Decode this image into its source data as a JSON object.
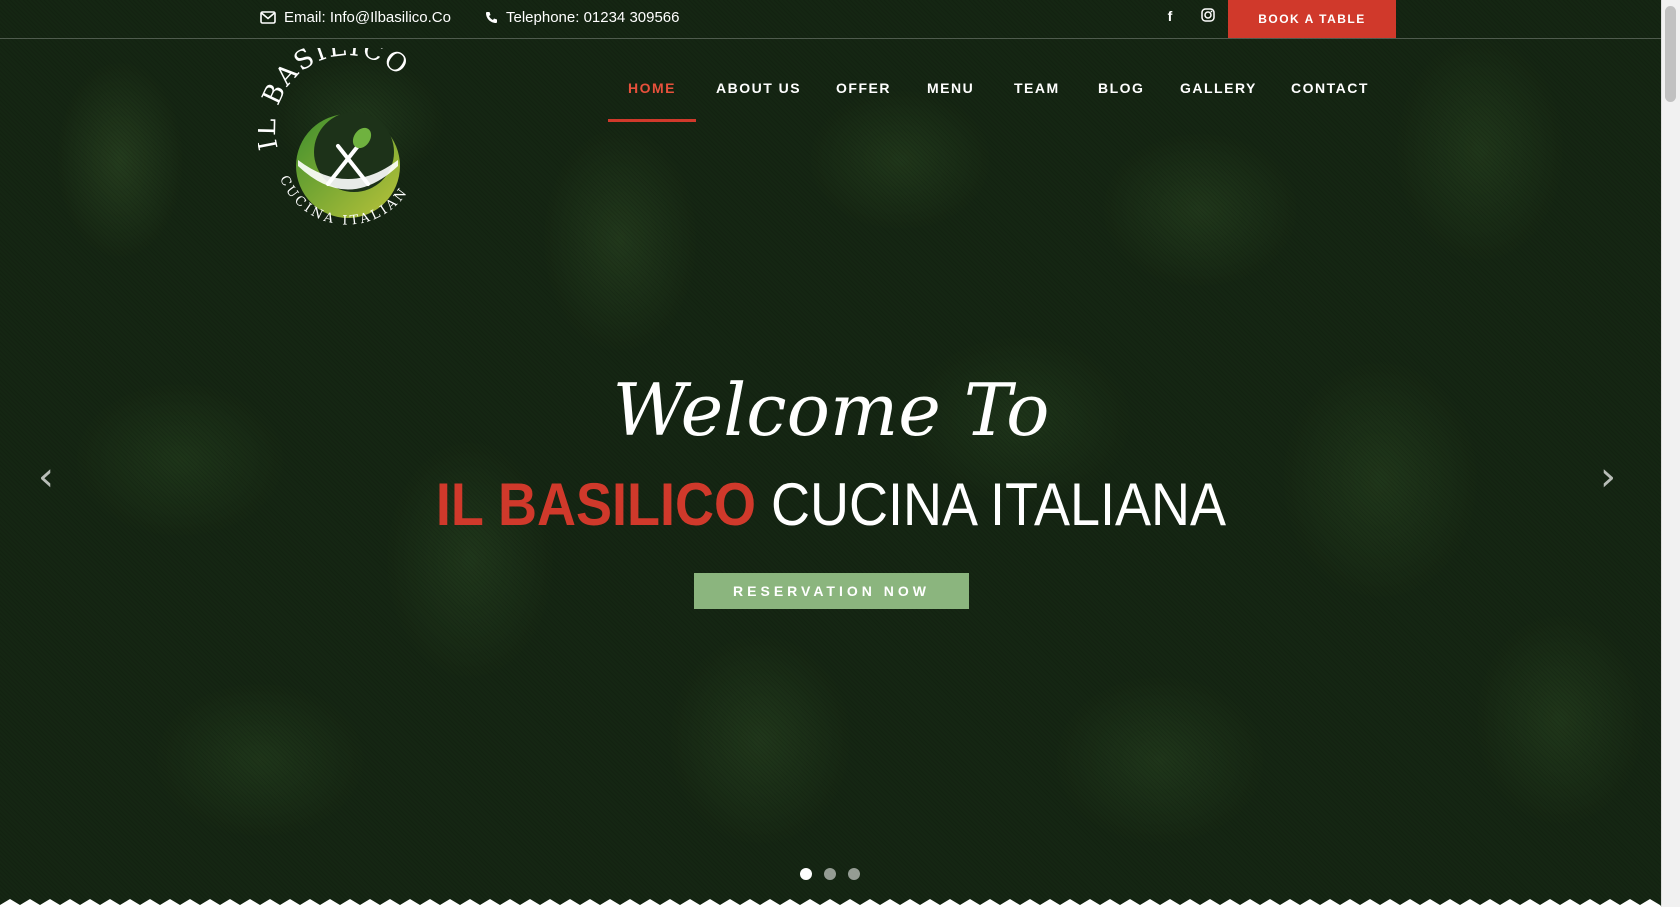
{
  "topbar": {
    "email_label": "Email: Info@Ilbasilico.Co",
    "phone_label": "Telephone: 01234 309566",
    "social": [
      {
        "icon": "facebook-icon",
        "glyph": "f"
      },
      {
        "icon": "instagram-icon",
        "glyph": "◎"
      }
    ],
    "book_label": "BOOK A TABLE"
  },
  "logo": {
    "top_text": "IL BASILICO",
    "bottom_text": "CUCINA ITALIANA"
  },
  "nav": {
    "items": [
      {
        "label": "HOME",
        "active": true
      },
      {
        "label": "ABOUT US",
        "active": false
      },
      {
        "label": "OFFER",
        "active": false
      },
      {
        "label": "MENU",
        "active": false
      },
      {
        "label": "TEAM",
        "active": false
      },
      {
        "label": "BLOG",
        "active": false
      },
      {
        "label": "GALLERY",
        "active": false
      },
      {
        "label": "CONTACT",
        "active": false
      }
    ]
  },
  "hero": {
    "welcome": "Welcome To",
    "title_highlight": "IL BASILICO",
    "title_rest": "CUCINA ITALIANA",
    "button_label": "RESERVATION NOW",
    "prev_glyph": "‹",
    "next_glyph": "›",
    "slides": 3,
    "active_slide": 1
  },
  "colors": {
    "accent": "#d0392b",
    "button_green": "#8bb57e",
    "logo_green": "#5aa33a"
  }
}
